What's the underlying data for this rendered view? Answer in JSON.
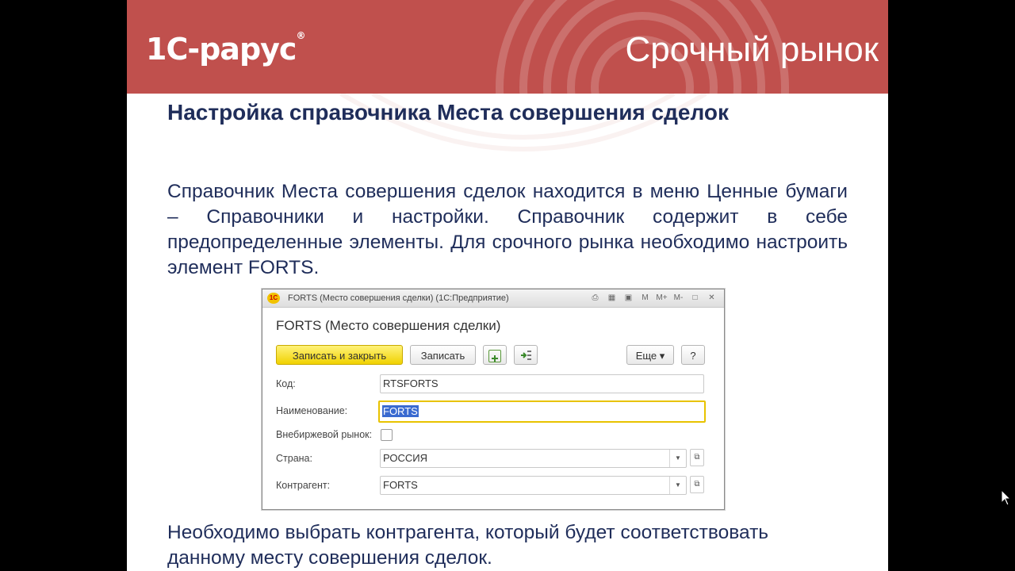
{
  "banner": {
    "logo_text": "1С-рарус",
    "logo_reg": "®",
    "title": "Срочный рынок"
  },
  "heading": "Настройка справочника Места совершения сделок",
  "paragraph1": "Справочник Места совершения сделок находится в меню Ценные бумаги – Справочники и настройки. Справочник содержит в себе предопределенные элементы. Для срочного рынка необходимо настроить элемент FORTS.",
  "paragraph2": "Необходимо выбрать контрагента, который будет соответствовать данному месту совершения сделок.",
  "window": {
    "titlebar_icon": "1С",
    "title": "FORTS (Место совершения сделки)  (1С:Предприятие)",
    "form_title": "FORTS (Место совершения сделки)",
    "toolbar": {
      "save_close": "Записать и закрыть",
      "save": "Записать",
      "more": "Еще",
      "more_arrow": "▾",
      "help": "?"
    },
    "fields": {
      "code_label": "Код:",
      "code_value": "RTSFORTS",
      "name_label": "Наименование:",
      "name_value": "FORTS",
      "otc_label": "Внебиржевой рынок:",
      "country_label": "Страна:",
      "country_value": "РОССИЯ",
      "counterparty_label": "Контрагент:",
      "counterparty_value": "FORTS"
    },
    "titlebar_buttons": [
      "M",
      "M+",
      "M-"
    ]
  },
  "colors": {
    "banner": "#c0504d",
    "text": "#1f2d5a",
    "primary_button": "#f0d200"
  }
}
